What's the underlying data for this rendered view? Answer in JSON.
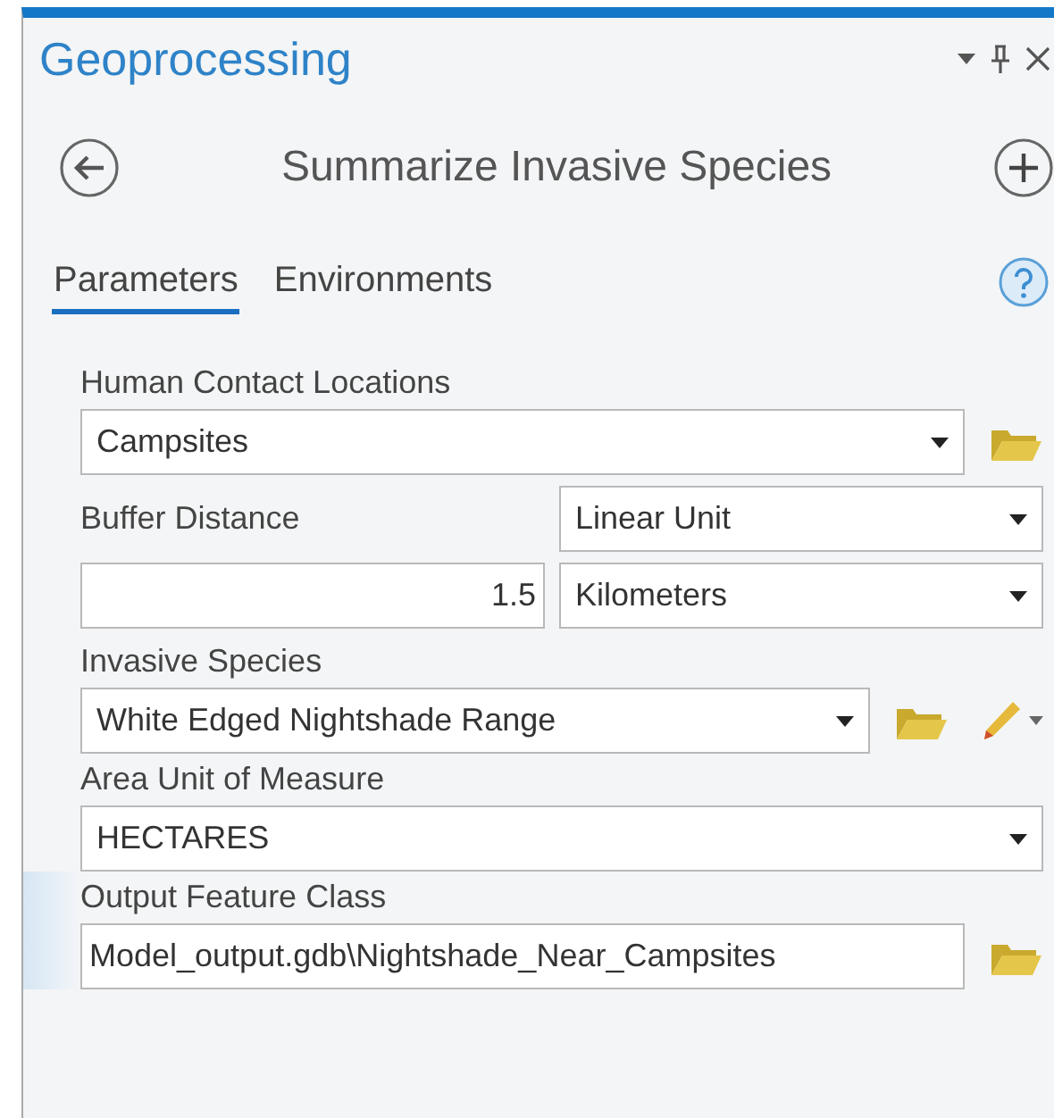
{
  "pane": {
    "title": "Geoprocessing"
  },
  "tool": {
    "title": "Summarize Invasive Species"
  },
  "tabs": [
    {
      "label": "Parameters",
      "selected": true
    },
    {
      "label": "Environments",
      "selected": false
    }
  ],
  "parameters": [
    {
      "kind": "dropdown",
      "label": "Human Contact Locations",
      "value": "Campsites",
      "browse": true
    },
    {
      "kind": "linear_unit",
      "label": "Buffer Distance",
      "unit_type": "Linear Unit",
      "value": "1.5",
      "unit": "Kilometers"
    },
    {
      "kind": "dropdown",
      "label": "Invasive Species",
      "value": "White Edged Nightshade Range",
      "browse": true,
      "edit": true
    },
    {
      "kind": "dropdown",
      "label": "Area Unit of Measure",
      "value": "HECTARES"
    },
    {
      "kind": "text",
      "label": "Output Feature Class",
      "value": "Model_output.gdb\\Nightshade_Near_Campsites",
      "browse": true,
      "active": true
    }
  ]
}
